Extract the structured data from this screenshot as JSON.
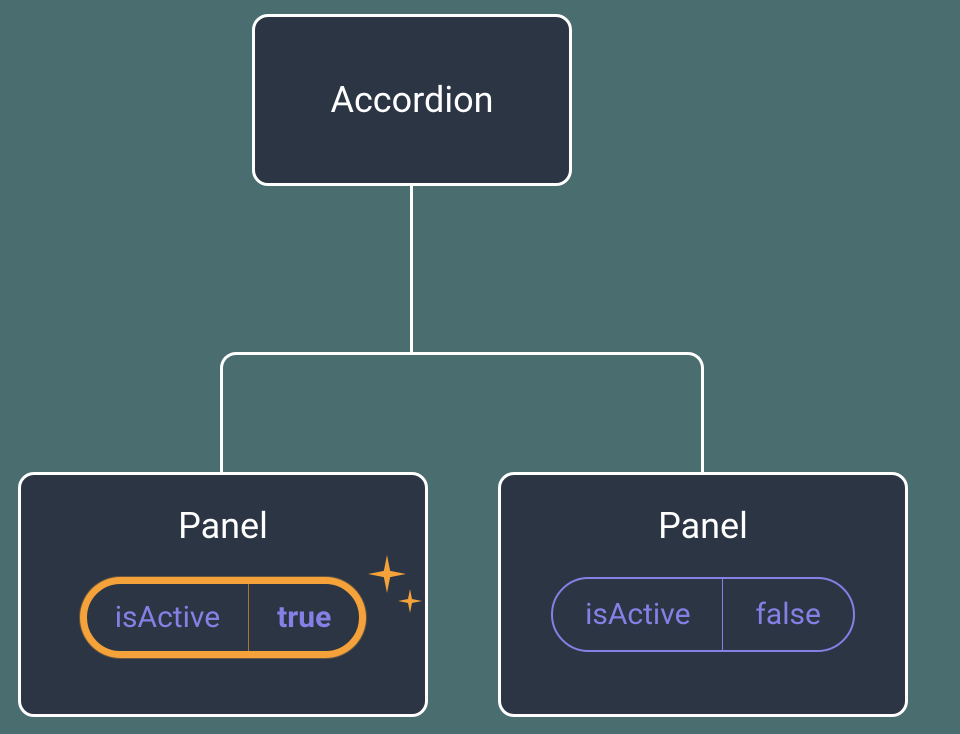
{
  "root": {
    "label": "Accordion"
  },
  "panels": [
    {
      "title": "Panel",
      "property": "isActive",
      "value": "true",
      "highlighted": true
    },
    {
      "title": "Panel",
      "property": "isActive",
      "value": "false",
      "highlighted": false
    }
  ],
  "colors": {
    "background": "#4a6d70",
    "nodeFill": "#2b3544",
    "nodeBorder": "#ffffff",
    "propertyText": "#8580e5",
    "highlight": "#f5a23a"
  }
}
